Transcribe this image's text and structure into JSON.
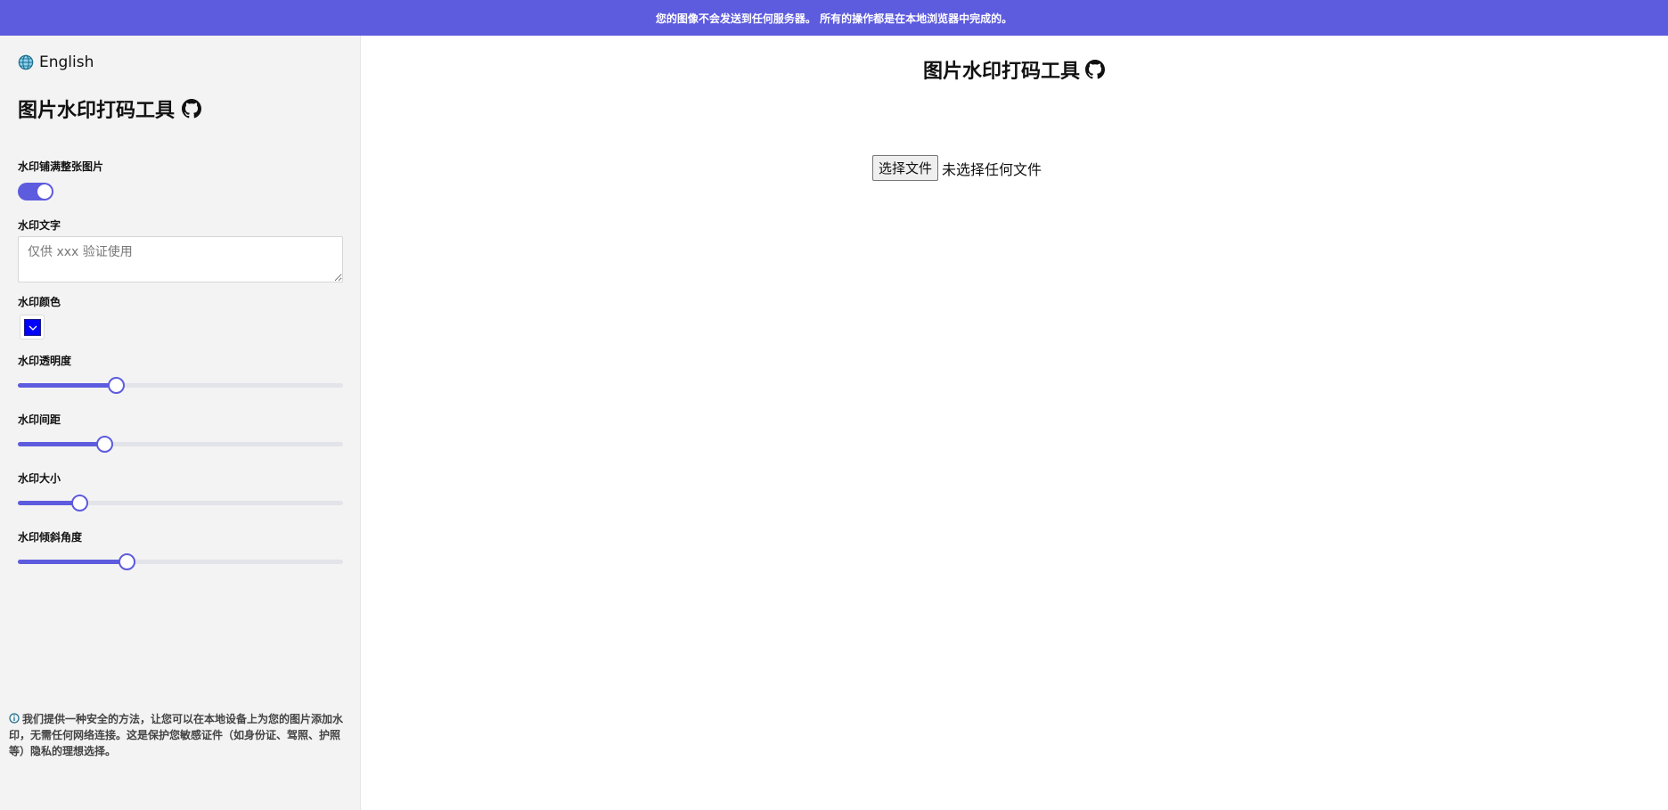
{
  "banner": {
    "text": "您的图像不会发送到任何服务器。 所有的操作都是在本地浏览器中完成的。"
  },
  "sidebar": {
    "language": "English",
    "title": "图片水印打码工具",
    "fields": {
      "tile_label": "水印铺满整张图片",
      "tile_enabled": true,
      "text_label": "水印文字",
      "text_placeholder": "仅供 xxx 验证使用",
      "color_label": "水印颜色",
      "color_value": "#0000ff",
      "opacity_label": "水印透明度",
      "opacity_percent": 30,
      "spacing_label": "水印间距",
      "spacing_percent": 26.5,
      "size_label": "水印大小",
      "size_percent": 19,
      "angle_label": "水印倾斜角度",
      "angle_percent": 33.5
    },
    "info_text": "我们提供一种安全的方法，让您可以在本地设备上为您的图片添加水印，无需任何网络连接。这是保护您敏感证件（如身份证、驾照、护照等）隐私的理想选择。"
  },
  "main": {
    "title": "图片水印打码工具",
    "choose_file_label": "选择文件",
    "no_file_text": "未选择任何文件"
  },
  "colors": {
    "accent": "#5d5bde",
    "sidebar_bg": "#f3f3f3"
  },
  "icons": {
    "language": "globe-icon",
    "repo": "github-icon",
    "info": "info-circle-icon",
    "dropdown": "chevron-down-icon"
  }
}
